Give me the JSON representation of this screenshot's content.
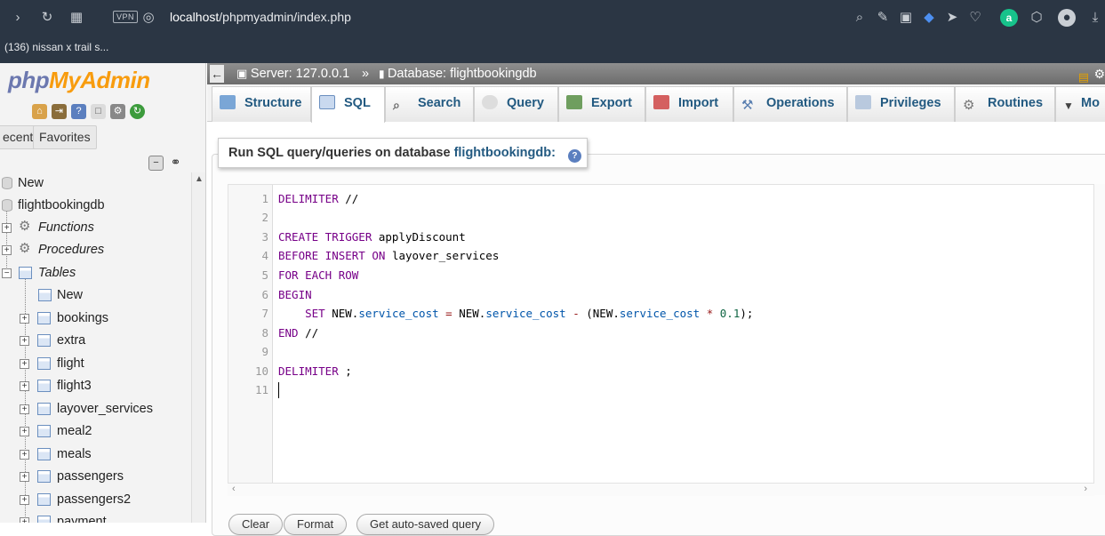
{
  "browser": {
    "url_host": "localhost",
    "url_path": "/phpmyadmin/index.php",
    "vpn_label": "VPN",
    "bookmark": "(136) nissan x trail s..."
  },
  "sidebar": {
    "logo_part1": "php",
    "logo_part2": "MyAdmin",
    "recent_label": "ecent",
    "favorites_label": "Favorites",
    "tree": {
      "new": "New",
      "db": "flightbookingdb",
      "functions": "Functions",
      "procedures": "Procedures",
      "tables": "Tables",
      "tables_new": "New",
      "table_items": [
        "bookings",
        "extra",
        "flight",
        "flight3",
        "layover_services",
        "meal2",
        "meals",
        "passengers",
        "passengers2",
        "payment"
      ]
    }
  },
  "breadcrumb": {
    "server": "Server: 127.0.0.1",
    "separator": "»",
    "database": "Database: flightbookingdb"
  },
  "tabs": [
    "Structure",
    "SQL",
    "Search",
    "Query",
    "Export",
    "Import",
    "Operations",
    "Privileges",
    "Routines",
    "Mo"
  ],
  "active_tab": "SQL",
  "query_panel": {
    "label": "Run SQL query/queries on database",
    "db_name": "flightbookingdb:"
  },
  "editor": {
    "line_numbers": [
      "1",
      "2",
      "3",
      "4",
      "5",
      "6",
      "7",
      "8",
      "9",
      "10",
      "11"
    ]
  },
  "buttons": {
    "clear": "Clear",
    "format": "Format",
    "get_auto_saved": "Get auto-saved query"
  }
}
